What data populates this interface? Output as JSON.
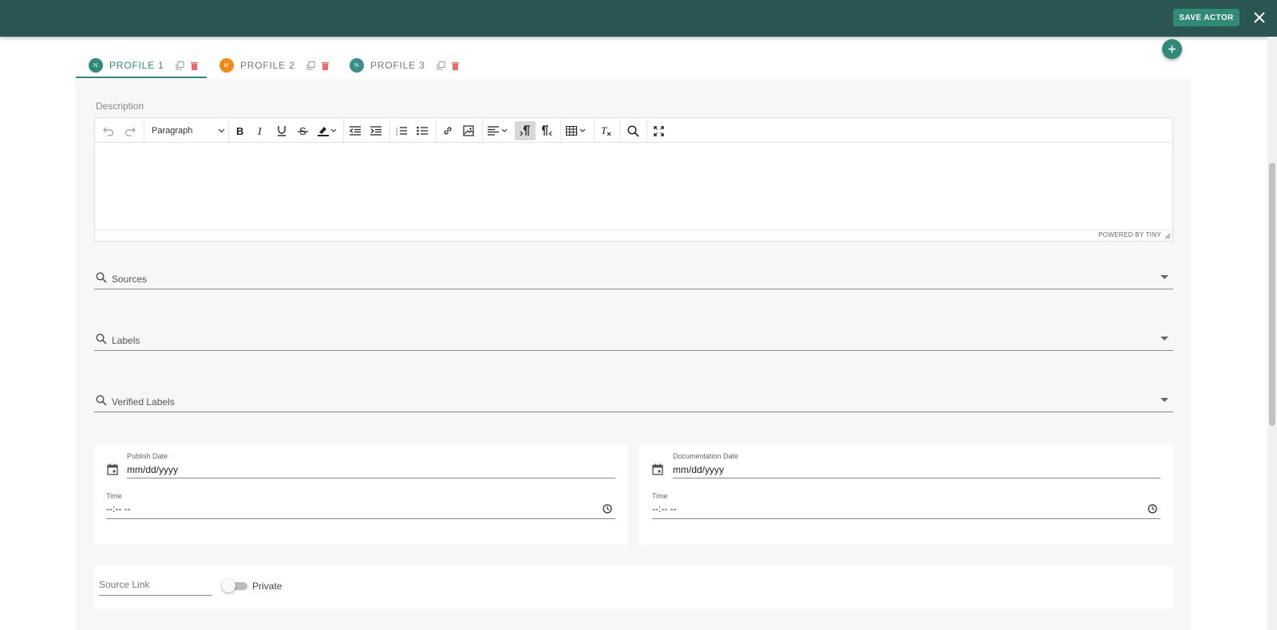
{
  "header": {
    "save_label": "SAVE ACTOR",
    "bar_color": "#2b5552",
    "accent_color": "#2f8a78"
  },
  "tabs": [
    {
      "label": "PROFILE 1",
      "avatar": "N",
      "avatar_color": "#2f8a78",
      "active": true
    },
    {
      "label": "PROFILE 2",
      "avatar": "M",
      "avatar_color": "#f08a11",
      "active": false
    },
    {
      "label": "PROFILE 3",
      "avatar": "N",
      "avatar_color": "#3a8f87",
      "active": false
    }
  ],
  "description": {
    "label": "Description",
    "block_format": "Paragraph",
    "powered_by": "POWERED BY TINY",
    "toolbar_icons": [
      "undo-icon",
      "redo-icon",
      "bold-icon",
      "italic-icon",
      "underline-icon",
      "strikethrough-icon",
      "highlight-icon",
      "outdent-icon",
      "indent-icon",
      "numbered-list-icon",
      "bullet-list-icon",
      "link-icon",
      "image-icon",
      "align-icon",
      "ltr-icon",
      "rtl-icon",
      "table-icon",
      "clear-format-icon",
      "search-icon",
      "fullscreen-icon"
    ]
  },
  "fields": {
    "sources": "Sources",
    "labels": "Labels",
    "verified_labels": "Verified Labels"
  },
  "publish": {
    "label": "Publish Date",
    "date_value": "mm/dd/yyyy",
    "time_label": "Time",
    "time_value": "--:-- --"
  },
  "documentation": {
    "label": "Documentation Date",
    "date_value": "mm/dd/yyyy",
    "time_label": "Time",
    "time_value": "--:-- --"
  },
  "source_link": {
    "placeholder": "Source Link",
    "private_label": "Private",
    "private_on": false
  }
}
